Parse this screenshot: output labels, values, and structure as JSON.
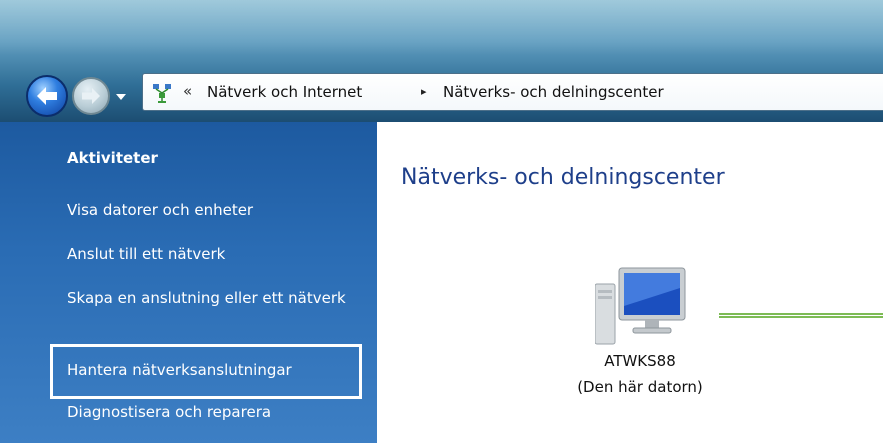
{
  "address_bar": {
    "overflow_chevron": "«",
    "breadcrumb": [
      "Nätverk och Internet",
      "Nätverks- och delningscenter"
    ],
    "separator": "▸"
  },
  "sidebar": {
    "title": "Aktiviteter",
    "links": [
      "Visa datorer och enheter",
      "Anslut till ett nätverk",
      "Skapa en anslutning eller ett nätverk",
      "Hantera nätverksanslutningar",
      "Diagnostisera och reparera"
    ]
  },
  "content": {
    "title": "Nätverks- och delningscenter",
    "computer": {
      "name": "ATWKS88",
      "subtitle": "(Den här datorn)"
    }
  },
  "colors": {
    "sidebar_bg": "#2a6cb4",
    "content_title": "#1e3f8a",
    "network_line": "#7dbb55",
    "highlight_border": "#ffffff"
  },
  "icons": [
    "back-arrow-icon",
    "forward-arrow-icon",
    "recent-pages-dropdown-icon",
    "network-center-icon",
    "computer-icon"
  ]
}
